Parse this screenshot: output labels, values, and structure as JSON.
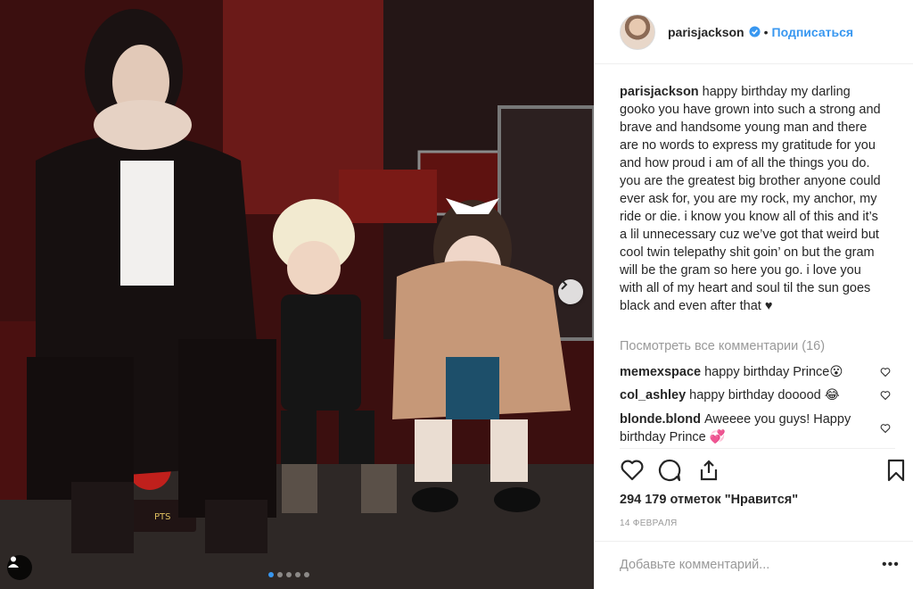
{
  "post": {
    "author": "parisjackson",
    "follow_label": "Подписаться",
    "separator": "•",
    "caption": "happy birthday my darling gooko you have grown into such a strong and brave and handsome young man and there are no words to express my gratitude for you and how proud i am of all the things you do. you are the greatest big brother anyone could ever ask for, you are my rock, my anchor, my ride or die. i know you know all of this and it’s a lil unnecessary cuz we’ve got that weird but cool twin telepathy shit goin’ on but the gram will be the gram so here you go. i love you with all of my heart and soul til the sun goes black and even after that ♥",
    "view_all_comments": "Посмотреть все комментарии (16)",
    "likes": "294 179 отметок \"Нравится\"",
    "date": "14 февраля",
    "add_comment_placeholder": "Добавьте комментарий...",
    "more_label": "•••",
    "photo_sign_text": "PTS"
  },
  "comments": [
    {
      "user": "memexspace",
      "text": "happy birthday Prince😮"
    },
    {
      "user": "col_ashley",
      "text": "happy birthday dooood 😂"
    },
    {
      "user": "blonde.blond",
      "text": "Aweeee you guys! Happy birthday Prince 💞"
    }
  ],
  "carousel": {
    "total": 5,
    "active": 0
  },
  "icons": {
    "verified": "verified-badge-icon",
    "like": "heart-icon",
    "comment": "comment-bubble-icon",
    "share": "share-icon",
    "save": "bookmark-icon",
    "next": "chevron-right-icon",
    "user_tag": "user-tag-icon"
  },
  "colors": {
    "accent": "#3897f0",
    "text": "#262626",
    "muted": "#999999",
    "border": "#efefef"
  }
}
